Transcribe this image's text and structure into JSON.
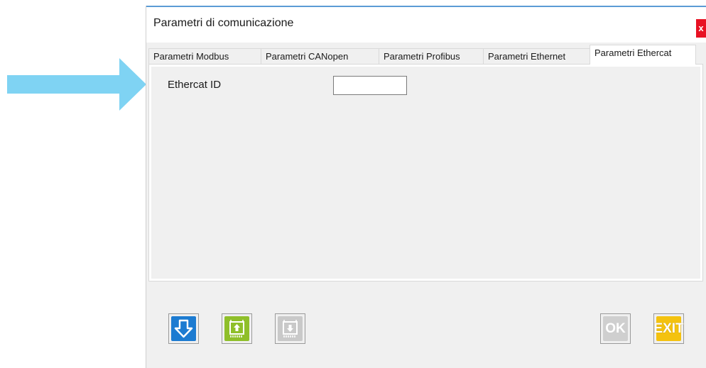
{
  "dialog": {
    "title": "Parametri di comunicazione",
    "close_label": "x"
  },
  "tabs": [
    {
      "label": "Parametri Modbus",
      "active": false
    },
    {
      "label": "Parametri CANopen",
      "active": false
    },
    {
      "label": "Parametri Profibus",
      "active": false
    },
    {
      "label": "Parametri Ethernet",
      "active": false
    },
    {
      "label": "Parametri Ethercat",
      "active": true
    }
  ],
  "ethercat": {
    "id_label": "Ethercat ID",
    "id_value": ""
  },
  "toolbar": {
    "download_icon": "arrow-down-icon",
    "upload_icon": "chip-upload-icon",
    "chip_download_icon": "chip-download-icon",
    "ok_label": "OK",
    "exit_label": "EXIT"
  },
  "colors": {
    "pointer_arrow": "#7fd3f3",
    "download_button": "#1c7bd1",
    "upload_button": "#8fbf2a",
    "exit_button": "#f4c20f",
    "close_button": "#e81123"
  }
}
